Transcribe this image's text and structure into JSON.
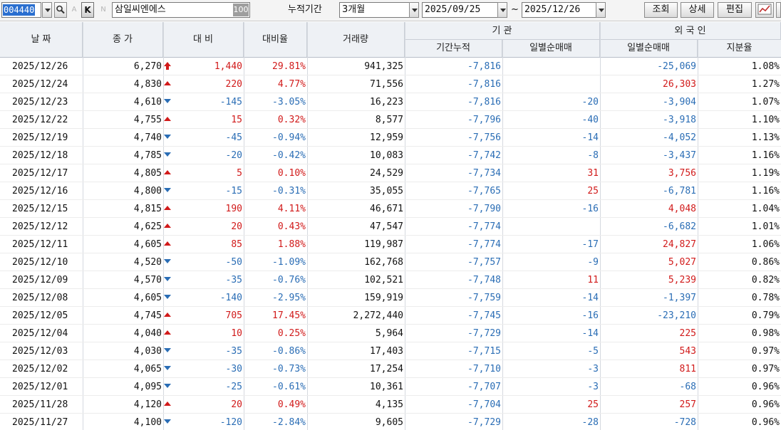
{
  "toolbar": {
    "code": "004440",
    "small_a": "A",
    "k": "K",
    "small_n": "N",
    "name": "삼일씨엔에스",
    "name_count": "100",
    "period_label": "누적기간",
    "period_value": "3개월",
    "start_date": "2025/09/25",
    "tilde": "~",
    "end_date": "2025/12/26",
    "query_btn": "조회",
    "detail_btn": "상세",
    "edit_btn": "편집"
  },
  "header": {
    "date": "날 짜",
    "close": "종 가",
    "change": "대 비",
    "rate": "대비율",
    "volume": "거래량",
    "inst": "기   관",
    "inst_cum": "기간누적",
    "inst_daily": "일별순매매",
    "foreign": "외 국 인",
    "foreign_daily": "일별순매매",
    "foreign_ratio": "지분율"
  },
  "colors": {
    "up": "#d11a1a",
    "down": "#2a6db5",
    "selection": "#2a6fd0"
  },
  "rows": [
    {
      "date": "2025/12/26",
      "close": "6,270",
      "dir": "limit-up",
      "change": "1,440",
      "rate": "29.81%",
      "volume": "941,325",
      "inst_cum": "-7,816",
      "inst_daily": "",
      "inst_daily_dir": "",
      "frn_daily": "-25,069",
      "frn_dir": "down",
      "frn_ratio": "1.08%"
    },
    {
      "date": "2025/12/24",
      "close": "4,830",
      "dir": "up",
      "change": "220",
      "rate": "4.77%",
      "volume": "71,556",
      "inst_cum": "-7,816",
      "inst_daily": "",
      "inst_daily_dir": "",
      "frn_daily": "26,303",
      "frn_dir": "up",
      "frn_ratio": "1.27%"
    },
    {
      "date": "2025/12/23",
      "close": "4,610",
      "dir": "down",
      "change": "-145",
      "rate": "-3.05%",
      "volume": "16,223",
      "inst_cum": "-7,816",
      "inst_daily": "-20",
      "inst_daily_dir": "down",
      "frn_daily": "-3,904",
      "frn_dir": "down",
      "frn_ratio": "1.07%"
    },
    {
      "date": "2025/12/22",
      "close": "4,755",
      "dir": "up",
      "change": "15",
      "rate": "0.32%",
      "volume": "8,577",
      "inst_cum": "-7,796",
      "inst_daily": "-40",
      "inst_daily_dir": "down",
      "frn_daily": "-3,918",
      "frn_dir": "down",
      "frn_ratio": "1.10%"
    },
    {
      "date": "2025/12/19",
      "close": "4,740",
      "dir": "down",
      "change": "-45",
      "rate": "-0.94%",
      "volume": "12,959",
      "inst_cum": "-7,756",
      "inst_daily": "-14",
      "inst_daily_dir": "down",
      "frn_daily": "-4,052",
      "frn_dir": "down",
      "frn_ratio": "1.13%"
    },
    {
      "date": "2025/12/18",
      "close": "4,785",
      "dir": "down",
      "change": "-20",
      "rate": "-0.42%",
      "volume": "10,083",
      "inst_cum": "-7,742",
      "inst_daily": "-8",
      "inst_daily_dir": "down",
      "frn_daily": "-3,437",
      "frn_dir": "down",
      "frn_ratio": "1.16%"
    },
    {
      "date": "2025/12/17",
      "close": "4,805",
      "dir": "up",
      "change": "5",
      "rate": "0.10%",
      "volume": "24,529",
      "inst_cum": "-7,734",
      "inst_daily": "31",
      "inst_daily_dir": "up",
      "frn_daily": "3,756",
      "frn_dir": "up",
      "frn_ratio": "1.19%"
    },
    {
      "date": "2025/12/16",
      "close": "4,800",
      "dir": "down",
      "change": "-15",
      "rate": "-0.31%",
      "volume": "35,055",
      "inst_cum": "-7,765",
      "inst_daily": "25",
      "inst_daily_dir": "up",
      "frn_daily": "-6,781",
      "frn_dir": "down",
      "frn_ratio": "1.16%"
    },
    {
      "date": "2025/12/15",
      "close": "4,815",
      "dir": "up",
      "change": "190",
      "rate": "4.11%",
      "volume": "46,671",
      "inst_cum": "-7,790",
      "inst_daily": "-16",
      "inst_daily_dir": "down",
      "frn_daily": "4,048",
      "frn_dir": "up",
      "frn_ratio": "1.04%"
    },
    {
      "date": "2025/12/12",
      "close": "4,625",
      "dir": "up",
      "change": "20",
      "rate": "0.43%",
      "volume": "47,547",
      "inst_cum": "-7,774",
      "inst_daily": "",
      "inst_daily_dir": "",
      "frn_daily": "-6,682",
      "frn_dir": "down",
      "frn_ratio": "1.01%"
    },
    {
      "date": "2025/12/11",
      "close": "4,605",
      "dir": "up",
      "change": "85",
      "rate": "1.88%",
      "volume": "119,987",
      "inst_cum": "-7,774",
      "inst_daily": "-17",
      "inst_daily_dir": "down",
      "frn_daily": "24,827",
      "frn_dir": "up",
      "frn_ratio": "1.06%"
    },
    {
      "date": "2025/12/10",
      "close": "4,520",
      "dir": "down",
      "change": "-50",
      "rate": "-1.09%",
      "volume": "162,768",
      "inst_cum": "-7,757",
      "inst_daily": "-9",
      "inst_daily_dir": "down",
      "frn_daily": "5,027",
      "frn_dir": "up",
      "frn_ratio": "0.86%"
    },
    {
      "date": "2025/12/09",
      "close": "4,570",
      "dir": "down",
      "change": "-35",
      "rate": "-0.76%",
      "volume": "102,521",
      "inst_cum": "-7,748",
      "inst_daily": "11",
      "inst_daily_dir": "up",
      "frn_daily": "5,239",
      "frn_dir": "up",
      "frn_ratio": "0.82%"
    },
    {
      "date": "2025/12/08",
      "close": "4,605",
      "dir": "down",
      "change": "-140",
      "rate": "-2.95%",
      "volume": "159,919",
      "inst_cum": "-7,759",
      "inst_daily": "-14",
      "inst_daily_dir": "down",
      "frn_daily": "-1,397",
      "frn_dir": "down",
      "frn_ratio": "0.78%"
    },
    {
      "date": "2025/12/05",
      "close": "4,745",
      "dir": "up",
      "change": "705",
      "rate": "17.45%",
      "volume": "2,272,440",
      "inst_cum": "-7,745",
      "inst_daily": "-16",
      "inst_daily_dir": "down",
      "frn_daily": "-23,210",
      "frn_dir": "down",
      "frn_ratio": "0.79%"
    },
    {
      "date": "2025/12/04",
      "close": "4,040",
      "dir": "up",
      "change": "10",
      "rate": "0.25%",
      "volume": "5,964",
      "inst_cum": "-7,729",
      "inst_daily": "-14",
      "inst_daily_dir": "down",
      "frn_daily": "225",
      "frn_dir": "up",
      "frn_ratio": "0.98%"
    },
    {
      "date": "2025/12/03",
      "close": "4,030",
      "dir": "down",
      "change": "-35",
      "rate": "-0.86%",
      "volume": "17,403",
      "inst_cum": "-7,715",
      "inst_daily": "-5",
      "inst_daily_dir": "down",
      "frn_daily": "543",
      "frn_dir": "up",
      "frn_ratio": "0.97%"
    },
    {
      "date": "2025/12/02",
      "close": "4,065",
      "dir": "down",
      "change": "-30",
      "rate": "-0.73%",
      "volume": "17,254",
      "inst_cum": "-7,710",
      "inst_daily": "-3",
      "inst_daily_dir": "down",
      "frn_daily": "811",
      "frn_dir": "up",
      "frn_ratio": "0.97%"
    },
    {
      "date": "2025/12/01",
      "close": "4,095",
      "dir": "down",
      "change": "-25",
      "rate": "-0.61%",
      "volume": "10,361",
      "inst_cum": "-7,707",
      "inst_daily": "-3",
      "inst_daily_dir": "down",
      "frn_daily": "-68",
      "frn_dir": "down",
      "frn_ratio": "0.96%"
    },
    {
      "date": "2025/11/28",
      "close": "4,120",
      "dir": "up",
      "change": "20",
      "rate": "0.49%",
      "volume": "4,135",
      "inst_cum": "-7,704",
      "inst_daily": "25",
      "inst_daily_dir": "up",
      "frn_daily": "257",
      "frn_dir": "up",
      "frn_ratio": "0.96%"
    },
    {
      "date": "2025/11/27",
      "close": "4,100",
      "dir": "down",
      "change": "-120",
      "rate": "-2.84%",
      "volume": "9,605",
      "inst_cum": "-7,729",
      "inst_daily": "-28",
      "inst_daily_dir": "down",
      "frn_daily": "-728",
      "frn_dir": "down",
      "frn_ratio": "0.96%"
    }
  ]
}
